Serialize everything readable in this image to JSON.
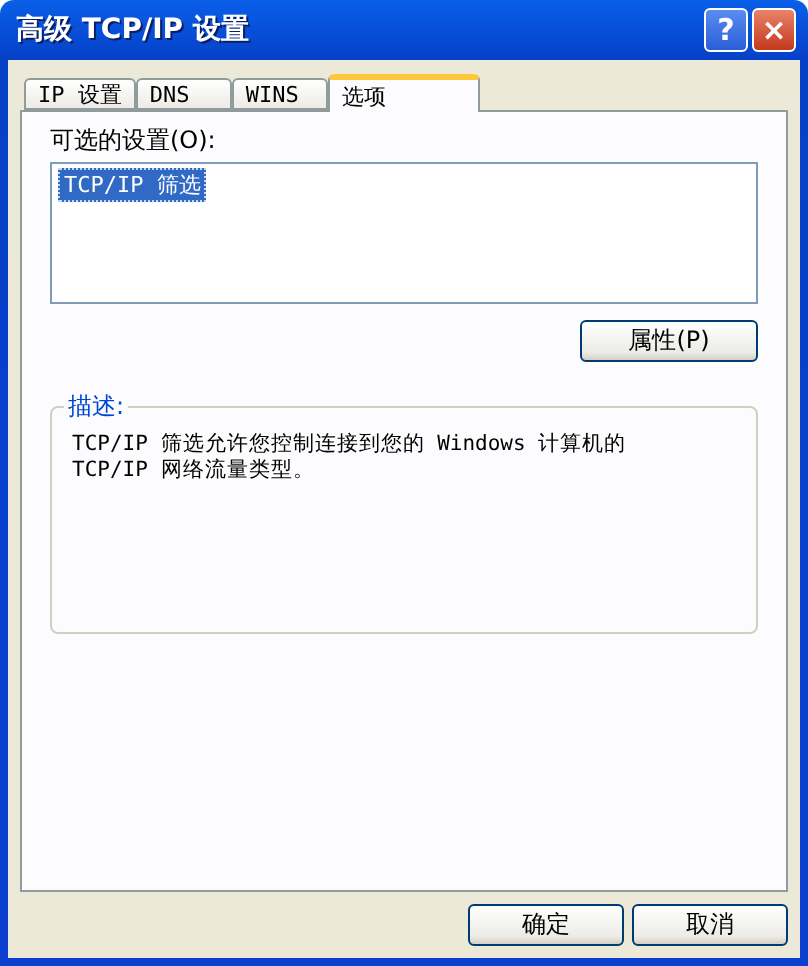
{
  "window": {
    "title": "高级 TCP/IP 设置",
    "title_buttons": [
      {
        "kind": "help",
        "label": "?"
      },
      {
        "kind": "close",
        "label": "×"
      }
    ]
  },
  "tabs": [
    {
      "label": "IP 设置",
      "selected": false
    },
    {
      "label": "DNS",
      "selected": false
    },
    {
      "label": "WINS",
      "selected": false
    },
    {
      "label": "选项",
      "selected": true
    }
  ],
  "optional_settings": {
    "label": "可选的设置(O):",
    "items": [
      {
        "label": "TCP/IP 筛选",
        "selected": true
      }
    ],
    "properties_button": "属性(P)"
  },
  "description": {
    "title": "描述:",
    "text": "TCP/IP 筛选允许您控制连接到您的 Windows 计算机的\nTCP/IP 网络流量类型。"
  },
  "buttons": [
    "确定",
    "取消"
  ]
}
